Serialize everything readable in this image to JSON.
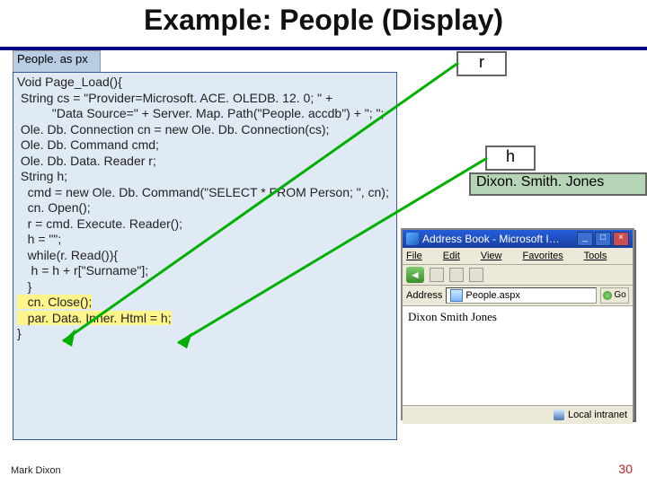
{
  "title": "Example: People (Display)",
  "file_tab": "People. as\npx",
  "code": {
    "l1": "Void Page_Load(){",
    "l2": " String cs = \"Provider=Microsoft. ACE. OLEDB. 12. 0; \" + ",
    "l3": "          \"Data Source=\" + Server. Map. Path(\"People. accdb\") + \"; \";",
    "l4": " Ole. Db. Connection cn = new Ole. Db. Connection(cs);",
    "l5": " Ole. Db. Command cmd;",
    "l6": " Ole. Db. Data. Reader r;",
    "l7": " String h;",
    "l8": "   cmd = new Ole. Db. Command(\"SELECT * FROM Person; \", cn);",
    "l9": "   cn. Open();",
    "l10": "   r = cmd. Execute. Reader();",
    "l11": "   h = \"\";",
    "l12": "   while(r. Read()){",
    "l13": "    h = h + r[\"Surname\"];",
    "l14": "   }",
    "l15": "   cn. Close();",
    "l16": "   par. Data. Inner. Html = h;",
    "l17": "}"
  },
  "callout_r": "r",
  "callout_h": "h",
  "callout_names": "Dixon. Smith. Jones",
  "browser": {
    "title": "Address Book - Microsoft I…",
    "min": "_",
    "max": "□",
    "close": "×",
    "menu_file": "File",
    "menu_edit": "Edit",
    "menu_view": "View",
    "menu_fav": "Favorites",
    "menu_tools": "Tools",
    "back_glyph": "◄",
    "addr_label": "Address",
    "addr_value": "People.aspx",
    "go_label": "Go",
    "body": "Dixon Smith Jones",
    "zone": "Local intranet"
  },
  "footer_author": "Mark Dixon",
  "footer_page": "30"
}
